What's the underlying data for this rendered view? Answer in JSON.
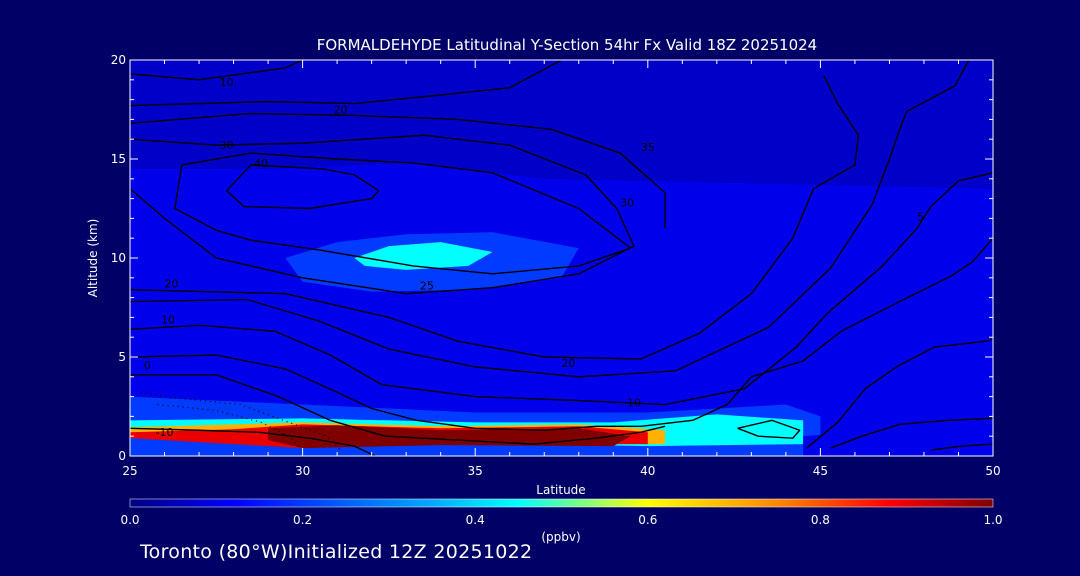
{
  "chart_data": {
    "type": "heatmap",
    "title": "FORMALDEHYDE Latitudinal Y-Section 54hr  Fx Valid 18Z 20251024",
    "xlabel": "Latitude",
    "ylabel": "Altitude (km)",
    "xlim": [
      25,
      50
    ],
    "ylim": [
      0,
      20
    ],
    "x_ticks": [
      25,
      30,
      35,
      40,
      45,
      50
    ],
    "y_ticks": [
      0,
      5,
      10,
      15,
      20
    ],
    "colorbar": {
      "unit": "(ppbv)",
      "range": [
        0.0,
        1.0
      ],
      "ticks": [
        "0.0",
        "0.2",
        "0.4",
        "0.6",
        "0.8",
        "1.0"
      ]
    },
    "concentration_regions": [
      {
        "value": 0.1,
        "points": [
          [
            25,
            14.5
          ],
          [
            29,
            14.5
          ],
          [
            33,
            14.8
          ],
          [
            37,
            14
          ],
          [
            50,
            13.5
          ],
          [
            50,
            0
          ],
          [
            25,
            0
          ]
        ]
      },
      {
        "value": 0.2,
        "points": [
          [
            29.5,
            10
          ],
          [
            31,
            10.8
          ],
          [
            33,
            11.2
          ],
          [
            35.5,
            11.3
          ],
          [
            38,
            10.5
          ],
          [
            37.5,
            9
          ],
          [
            35,
            8.4
          ],
          [
            32,
            8.3
          ],
          [
            30,
            8.8
          ]
        ]
      },
      {
        "value": 0.45,
        "points": [
          [
            31.5,
            10
          ],
          [
            32.5,
            10.6
          ],
          [
            34,
            10.8
          ],
          [
            35.5,
            10.3
          ],
          [
            34.8,
            9.6
          ],
          [
            33,
            9.4
          ],
          [
            31.8,
            9.6
          ]
        ]
      },
      {
        "value": 0.2,
        "points": [
          [
            25,
            3
          ],
          [
            30,
            2.6
          ],
          [
            35,
            2.2
          ],
          [
            40,
            2.2
          ],
          [
            44,
            2.6
          ],
          [
            45,
            2.0
          ],
          [
            45,
            0
          ],
          [
            25,
            0
          ]
        ]
      },
      {
        "value": 0.45,
        "points": [
          [
            25,
            1.8
          ],
          [
            30,
            1.9
          ],
          [
            35,
            1.7
          ],
          [
            39,
            1.7
          ],
          [
            42,
            2.1
          ],
          [
            44.5,
            1.8
          ],
          [
            44.5,
            0.6
          ],
          [
            40,
            0.5
          ],
          [
            25,
            0.9
          ]
        ]
      },
      {
        "value": 0.7,
        "points": [
          [
            25,
            1.45
          ],
          [
            30,
            1.7
          ],
          [
            34,
            1.5
          ],
          [
            38,
            1.6
          ],
          [
            40.5,
            1.3
          ],
          [
            40.5,
            0.6
          ],
          [
            35,
            0.6
          ],
          [
            25,
            1.0
          ]
        ]
      },
      {
        "value": 0.9,
        "points": [
          [
            25,
            1.2
          ],
          [
            28,
            1.35
          ],
          [
            30,
            1.6
          ],
          [
            34,
            1.4
          ],
          [
            38,
            1.5
          ],
          [
            40,
            1.2
          ],
          [
            40,
            0.6
          ],
          [
            34,
            0.6
          ],
          [
            30,
            0.4
          ],
          [
            25,
            0.9
          ]
        ]
      },
      {
        "value": 1.0,
        "points": [
          [
            29,
            1.4
          ],
          [
            31,
            1.55
          ],
          [
            34,
            1.3
          ],
          [
            38,
            1.4
          ],
          [
            39.5,
            1.0
          ],
          [
            39,
            0.5
          ],
          [
            34,
            0.55
          ],
          [
            30,
            0.4
          ],
          [
            29,
            0.8
          ]
        ]
      },
      {
        "value": 0.1,
        "points": [
          [
            44.5,
            1.0
          ],
          [
            46,
            1.2
          ],
          [
            48,
            1.0
          ],
          [
            50,
            1.0
          ],
          [
            50,
            0
          ],
          [
            44.5,
            0
          ]
        ]
      }
    ],
    "contour_labels": [
      {
        "text": "10",
        "x": 27.8,
        "y": 18.9
      },
      {
        "text": "20",
        "x": 31.1,
        "y": 17.5
      },
      {
        "text": "30",
        "x": 27.8,
        "y": 15.7
      },
      {
        "text": "40",
        "x": 28.8,
        "y": 14.8
      },
      {
        "text": "35",
        "x": 40.0,
        "y": 15.6
      },
      {
        "text": "30",
        "x": 39.4,
        "y": 12.8
      },
      {
        "text": "25",
        "x": 33.6,
        "y": 8.6
      },
      {
        "text": "20",
        "x": 26.2,
        "y": 8.7
      },
      {
        "text": "10",
        "x": 26.1,
        "y": 6.9
      },
      {
        "text": "0",
        "x": 25.5,
        "y": 4.6
      },
      {
        "text": "20",
        "x": 37.7,
        "y": 4.7
      },
      {
        "text": "10",
        "x": 39.6,
        "y": 2.7
      },
      {
        "text": "-10",
        "x": 26.0,
        "y": 1.2
      },
      {
        "text": "5",
        "x": 47.9,
        "y": 12.1
      }
    ],
    "contours": [
      [
        [
          25,
          19.3
        ],
        [
          27,
          19.0
        ],
        [
          29.5,
          19.6
        ],
        [
          30,
          20
        ]
      ],
      [
        [
          25,
          17.7
        ],
        [
          29,
          17.9
        ],
        [
          31.5,
          17.8
        ],
        [
          33.8,
          18.2
        ],
        [
          36,
          18.6
        ],
        [
          37.5,
          20
        ]
      ],
      [
        [
          25,
          16.8
        ],
        [
          28.5,
          17.3
        ],
        [
          31.5,
          17.2
        ],
        [
          34.5,
          17.0
        ],
        [
          37.2,
          16.5
        ],
        [
          39.2,
          15.3
        ],
        [
          40.5,
          13.3
        ],
        [
          40.5,
          11.5
        ]
      ],
      [
        [
          25,
          16.0
        ],
        [
          27.5,
          15.7
        ],
        [
          30,
          15.8
        ],
        [
          33.5,
          16.2
        ],
        [
          36,
          15.7
        ],
        [
          38.2,
          14.2
        ],
        [
          39.1,
          12.5
        ],
        [
          39.6,
          10.6
        ],
        [
          38,
          9.2
        ],
        [
          35.5,
          8.5
        ],
        [
          33,
          8.2
        ],
        [
          30,
          9.0
        ],
        [
          27.5,
          10.0
        ],
        [
          26,
          12
        ],
        [
          25,
          13.5
        ]
      ],
      [
        [
          26.5,
          14.7
        ],
        [
          28.5,
          15.3
        ],
        [
          31,
          15.0
        ],
        [
          33.2,
          14.8
        ],
        [
          35.5,
          14.3
        ],
        [
          38,
          12.5
        ],
        [
          39.5,
          10.5
        ],
        [
          38,
          9.6
        ],
        [
          35.5,
          9.2
        ],
        [
          33.2,
          9.6
        ],
        [
          30.5,
          10.4
        ],
        [
          28.5,
          10.9
        ],
        [
          27.5,
          11.4
        ],
        [
          26.3,
          12.5
        ],
        [
          26.5,
          14.7
        ]
      ],
      [
        [
          28.5,
          14.7
        ],
        [
          30.6,
          14.5
        ],
        [
          31.5,
          14.2
        ],
        [
          32.2,
          13.4
        ],
        [
          32.0,
          13.0
        ],
        [
          30.2,
          12.5
        ],
        [
          28.3,
          12.6
        ],
        [
          27.8,
          13.4
        ],
        [
          28.5,
          14.7
        ]
      ],
      [
        [
          25,
          8.4
        ],
        [
          29.5,
          8.2
        ],
        [
          32.5,
          7.0
        ],
        [
          34.5,
          5.8
        ],
        [
          37,
          5.0
        ],
        [
          39.8,
          4.9
        ],
        [
          41.5,
          6.2
        ],
        [
          43,
          8.2
        ],
        [
          44.2,
          11
        ],
        [
          44.8,
          13.5
        ],
        [
          46,
          14.7
        ],
        [
          46.1,
          16.2
        ],
        [
          45.5,
          17.8
        ],
        [
          45.1,
          19.2
        ]
      ],
      [
        [
          25,
          7.8
        ],
        [
          28.4,
          7.9
        ],
        [
          30.5,
          6.8
        ],
        [
          32.5,
          5.4
        ],
        [
          35,
          4.5
        ],
        [
          38,
          4.0
        ],
        [
          40.8,
          4.3
        ],
        [
          43.5,
          6.5
        ],
        [
          45.3,
          9.5
        ],
        [
          46.5,
          12.7
        ],
        [
          47,
          15
        ],
        [
          47.3,
          16.5
        ],
        [
          47.5,
          17.4
        ],
        [
          48.9,
          18.7
        ],
        [
          49.3,
          20
        ]
      ],
      [
        [
          25,
          6.4
        ],
        [
          27,
          6.6
        ],
        [
          29.2,
          6.3
        ],
        [
          30.8,
          5.1
        ],
        [
          32.3,
          3.6
        ],
        [
          35,
          3.0
        ],
        [
          38,
          2.8
        ],
        [
          40.5,
          2.6
        ],
        [
          42.8,
          3.4
        ],
        [
          44.3,
          5.5
        ],
        [
          45.2,
          7.2
        ],
        [
          46.8,
          9.6
        ],
        [
          47.8,
          11.5
        ],
        [
          48.2,
          12.6
        ],
        [
          49,
          13.9
        ],
        [
          50,
          14.3
        ]
      ],
      [
        [
          25,
          5.0
        ],
        [
          27.5,
          5.1
        ],
        [
          29.5,
          4.4
        ],
        [
          30.9,
          3.3
        ],
        [
          32,
          2.4
        ],
        [
          33.3,
          1.8
        ],
        [
          35,
          1.4
        ],
        [
          37,
          1.3
        ],
        [
          38.5,
          1.5
        ],
        [
          39.8,
          1.5
        ],
        [
          41.3,
          1.8
        ],
        [
          42.3,
          2.6
        ],
        [
          43,
          4.0
        ],
        [
          44.5,
          4.8
        ],
        [
          45.6,
          6.3
        ],
        [
          47.3,
          7.8
        ],
        [
          48.8,
          9.1
        ],
        [
          49.4,
          9.8
        ],
        [
          50,
          11
        ]
      ],
      [
        [
          25,
          4.1
        ],
        [
          27.5,
          4.1
        ],
        [
          29.3,
          3.0
        ],
        [
          30.8,
          1.8
        ],
        [
          32.4,
          1.0
        ],
        [
          36.7,
          0.6
        ],
        [
          38.5,
          0.9
        ],
        [
          39.8,
          1.2
        ],
        [
          40.5,
          1.5
        ]
      ],
      [
        [
          42.6,
          1.4
        ],
        [
          43.6,
          1.8
        ],
        [
          44.4,
          1.3
        ],
        [
          44.2,
          0.9
        ],
        [
          43.2,
          1.0
        ],
        [
          42.6,
          1.4
        ]
      ],
      [
        [
          44.6,
          0.4
        ],
        [
          45.5,
          1.7
        ],
        [
          46.3,
          3.4
        ],
        [
          47.2,
          4.5
        ],
        [
          48.3,
          5.5
        ],
        [
          49.8,
          5.8
        ],
        [
          50,
          5.9
        ]
      ],
      [
        [
          45.3,
          0.4
        ],
        [
          46.2,
          1.0
        ],
        [
          47.3,
          1.6
        ],
        [
          48.7,
          1.8
        ],
        [
          50,
          1.9
        ]
      ],
      [
        [
          25,
          1.4
        ],
        [
          27,
          1.3
        ],
        [
          28.7,
          1.2
        ],
        [
          30.2,
          0.9
        ],
        [
          31.5,
          0.5
        ],
        [
          32.1,
          0
        ]
      ],
      [
        [
          48.2,
          0.3
        ],
        [
          49.1,
          0.5
        ],
        [
          50,
          0.6
        ]
      ]
    ],
    "dotted_contours": [
      [
        [
          25.3,
          3.2
        ],
        [
          26.5,
          2.9
        ],
        [
          28.2,
          2.6
        ],
        [
          29.6,
          1.7
        ],
        [
          30.7,
          1.0
        ],
        [
          31.1,
          0.3
        ]
      ],
      [
        [
          25.8,
          2.6
        ],
        [
          27.5,
          2.3
        ],
        [
          28.8,
          1.7
        ],
        [
          29.6,
          1.0
        ],
        [
          30,
          0.3
        ]
      ]
    ]
  },
  "footer": {
    "location": "Toronto (80°W)",
    "initialized": "Initialized 12Z 20251022"
  }
}
